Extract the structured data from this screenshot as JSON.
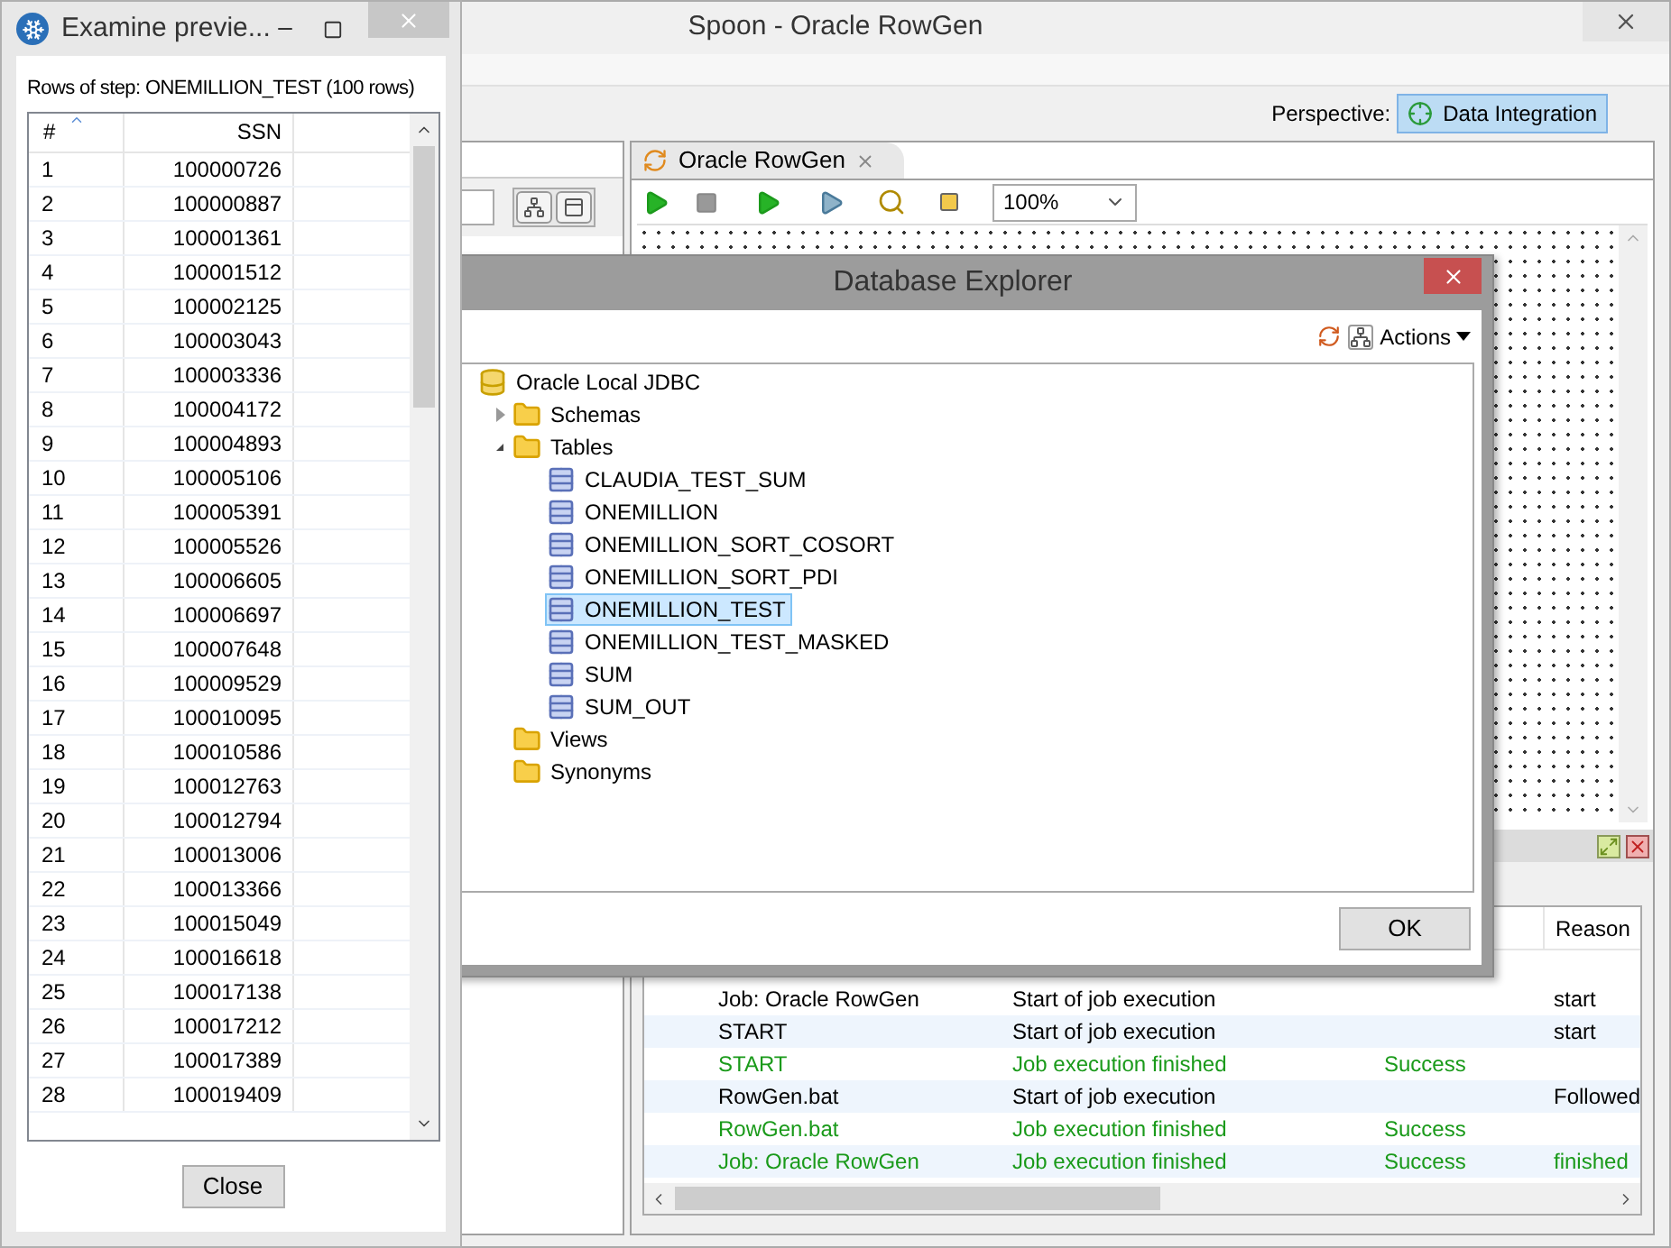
{
  "main_window": {
    "title": "Spoon - Oracle RowGen",
    "perspective_label": "Perspective:",
    "perspective": {
      "label": "Data Integration",
      "selected": true
    },
    "job_tab": {
      "label": "Oracle RowGen",
      "selected": true
    },
    "zoom": "100%",
    "log": {
      "columns": [
        "Reason"
      ],
      "rows": [
        {
          "job_entry": "Job: Oracle RowGen",
          "comment": "Start of job execution",
          "reason": "start",
          "color": "#000000"
        },
        {
          "job_entry": "START",
          "comment": "Start of job execution",
          "reason": "start",
          "color": "#000000"
        },
        {
          "job_entry": "START",
          "comment": "Job execution finished",
          "result": "Success",
          "color": "#1a9a1a"
        },
        {
          "job_entry": "RowGen.bat",
          "comment": "Start of job execution",
          "reason": "Followed",
          "color": "#000000"
        },
        {
          "job_entry": "RowGen.bat",
          "comment": "Job execution finished",
          "result": "Success",
          "color": "#1a9a1a"
        },
        {
          "job_entry": "Job: Oracle RowGen",
          "comment": "Job execution finished",
          "result": "Success",
          "reason": "finished",
          "color": "#1a9a1a"
        }
      ]
    }
  },
  "database_explorer": {
    "title": "Database Explorer",
    "actions": "Actions",
    "ok": "OK",
    "tree": [
      {
        "label": "Oracle Local JDBC",
        "kind": "connection",
        "selected": false,
        "children": [
          {
            "label": "Schemas",
            "kind": "folder",
            "expanded": false,
            "selected": false
          },
          {
            "label": "Tables",
            "kind": "folder",
            "expanded": true,
            "selected": false,
            "children": [
              {
                "label": "CLAUDIA_TEST_SUM",
                "kind": "table",
                "selected": false
              },
              {
                "label": "ONEMILLION",
                "kind": "table",
                "selected": false
              },
              {
                "label": "ONEMILLION_SORT_COSORT",
                "kind": "table",
                "selected": false
              },
              {
                "label": "ONEMILLION_SORT_PDI",
                "kind": "table",
                "selected": false
              },
              {
                "label": "ONEMILLION_TEST",
                "kind": "table",
                "selected": true
              },
              {
                "label": "ONEMILLION_TEST_MASKED",
                "kind": "table",
                "selected": false
              },
              {
                "label": "SUM",
                "kind": "table",
                "selected": false
              },
              {
                "label": "SUM_OUT",
                "kind": "table",
                "selected": false
              }
            ]
          },
          {
            "label": "Views",
            "kind": "folder",
            "selected": false
          },
          {
            "label": "Synonyms",
            "kind": "folder",
            "selected": false
          }
        ]
      }
    ]
  },
  "preview": {
    "title": "Examine previe...",
    "caption": "Rows of step: ONEMILLION_TEST (100 rows)",
    "columns": [
      "#",
      "SSN"
    ],
    "close": "Close",
    "rows": [
      [
        "1",
        "100000726"
      ],
      [
        "2",
        "100000887"
      ],
      [
        "3",
        "100001361"
      ],
      [
        "4",
        "100001512"
      ],
      [
        "5",
        "100002125"
      ],
      [
        "6",
        "100003043"
      ],
      [
        "7",
        "100003336"
      ],
      [
        "8",
        "100004172"
      ],
      [
        "9",
        "100004893"
      ],
      [
        "10",
        "100005106"
      ],
      [
        "11",
        "100005391"
      ],
      [
        "12",
        "100005526"
      ],
      [
        "13",
        "100006605"
      ],
      [
        "14",
        "100006697"
      ],
      [
        "15",
        "100007648"
      ],
      [
        "16",
        "100009529"
      ],
      [
        "17",
        "100010095"
      ],
      [
        "18",
        "100010586"
      ],
      [
        "19",
        "100012763"
      ],
      [
        "20",
        "100012794"
      ],
      [
        "21",
        "100013006"
      ],
      [
        "22",
        "100013366"
      ],
      [
        "23",
        "100015049"
      ],
      [
        "24",
        "100016618"
      ],
      [
        "25",
        "100017138"
      ],
      [
        "26",
        "100017212"
      ],
      [
        "27",
        "100017389"
      ],
      [
        "28",
        "100019409"
      ]
    ]
  }
}
